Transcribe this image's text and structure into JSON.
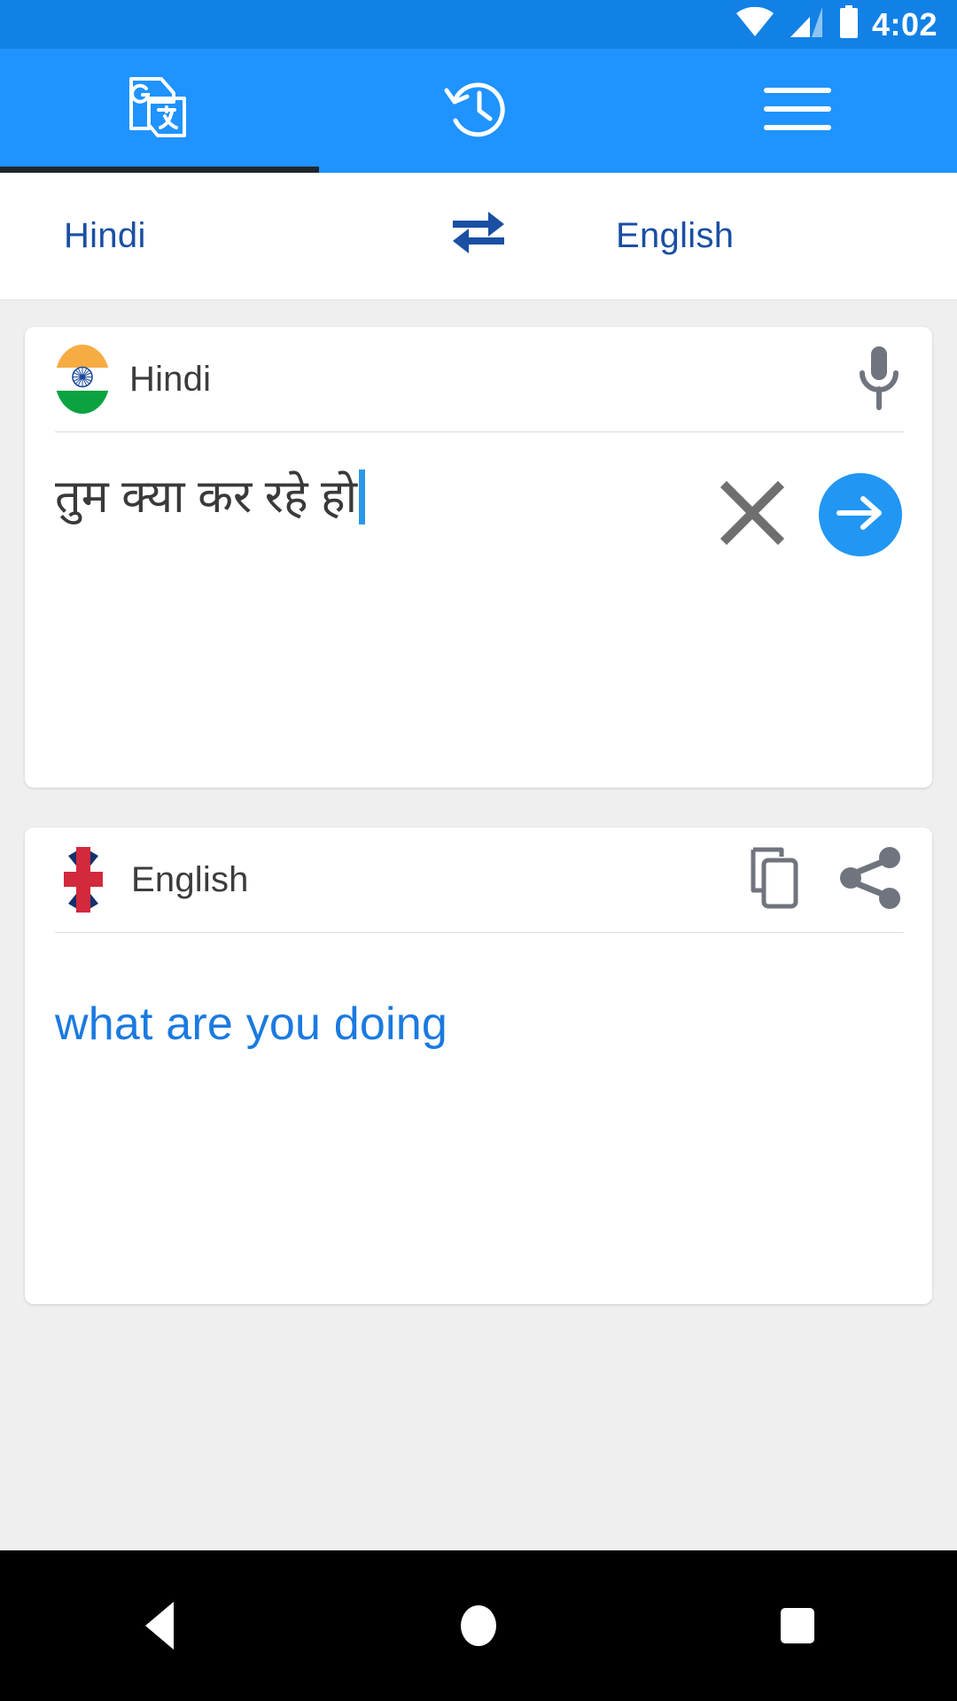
{
  "status_bar": {
    "time": "4:02",
    "icons": [
      "wifi-icon",
      "cellular-signal-icon",
      "battery-icon"
    ],
    "background_color": "#1281e5"
  },
  "tab_bar": {
    "background_color": "#1f93ff",
    "active_tab_index": 0,
    "indicator_color": "#20262b",
    "tabs": [
      {
        "name": "translate-tab",
        "icon": "google-translate-icon",
        "active": true
      },
      {
        "name": "history-tab",
        "icon": "history-clock-icon",
        "active": false
      },
      {
        "name": "menu-tab",
        "icon": "hamburger-menu-icon",
        "active": false
      }
    ]
  },
  "language_bar": {
    "source_language": "Hindi",
    "target_language": "English",
    "swap_icon": "swap-horizontal-arrows-icon",
    "text_color": "#1a4fa3"
  },
  "source_card": {
    "flag_icon": "india-flag-icon",
    "language": "Hindi",
    "mic_icon": "microphone-icon",
    "input_text": "तुम क्या कर रहे हो",
    "clear_icon": "close-x-icon",
    "translate_icon": "arrow-right-icon",
    "translate_button_color": "#2196f3",
    "has_cursor": true
  },
  "result_card": {
    "flag_icon": "uk-flag-icon",
    "language": "English",
    "copy_icon": "copy-icon",
    "share_icon": "share-icon",
    "translated_text": "what are you doing",
    "text_color": "#1b7ae0"
  },
  "nav_bar": {
    "background_color": "#000000",
    "buttons": [
      {
        "name": "nav-back-button",
        "icon": "back-triangle-icon"
      },
      {
        "name": "nav-home-button",
        "icon": "home-circle-icon"
      },
      {
        "name": "nav-recents-button",
        "icon": "recents-square-icon"
      }
    ]
  }
}
